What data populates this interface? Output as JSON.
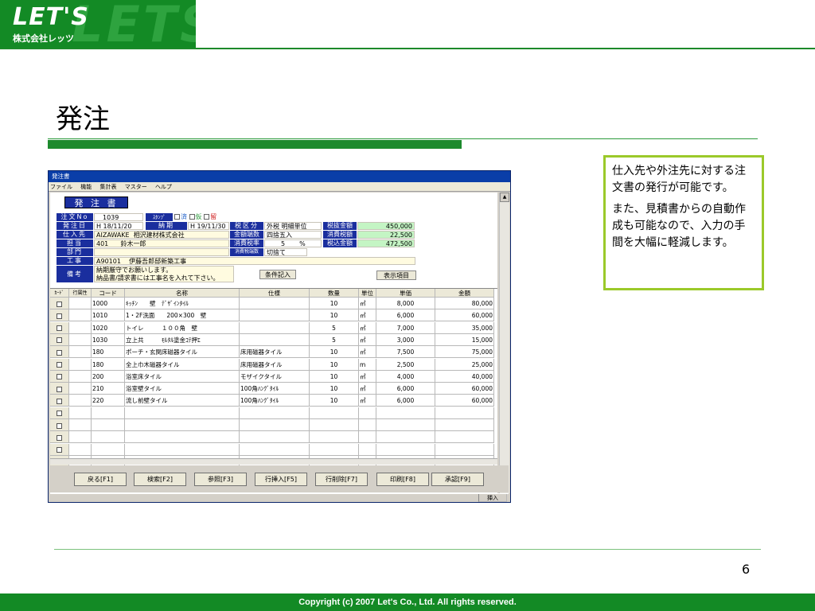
{
  "brand": {
    "logo_text": "LET'S",
    "watermark": "LETS",
    "company": "株式会社レッツ"
  },
  "slide": {
    "title": "発注",
    "page_number": "6",
    "footer": "Copyright (c) 2007 Let's Co., Ltd. All rights reserved.",
    "note_p1": "仕入先や外注先に対する注文書の発行が可能です。",
    "note_p2": "また、見積書からの自動作成も可能なので、入力の手間を大幅に軽減します。"
  },
  "window": {
    "title": "発注書",
    "menu": [
      "ファイル",
      "機能",
      "集計表",
      "マスター",
      "ヘルプ"
    ],
    "form_title": "発 注 書",
    "status_cell": "挿入"
  },
  "form": {
    "order_no_label": "注文No",
    "order_no": "1039",
    "stamp_label": "ｽﾀﾝﾌﾟ",
    "stamps": [
      "済",
      "仮",
      "留"
    ],
    "order_date_label": "発注日",
    "order_date": "H 18/11/20",
    "delivery_label": "納期",
    "delivery": "H 19/11/30",
    "supplier_label": "仕入先",
    "supplier_code": "AIZAWAKE",
    "supplier_name": "相沢建材株式会社",
    "staff_label": "担当",
    "staff_code": "401",
    "staff_name": "鈴木一郎",
    "dept_label": "部門",
    "project_label": "工事",
    "project_code": "A90101",
    "project_name": "伊藤吾郎邸新築工事",
    "notes_label": "備考",
    "notes_line1": "納期厳守でお願いします。",
    "notes_line2": "納品書/請求書には工事名を入れて下さい。",
    "tax_type_label": "税区分",
    "tax_type": "外税 明細単位",
    "rounding_label": "金額端数",
    "rounding": "四捨五入",
    "tax_rate_label": "消費税率",
    "tax_rate": "5",
    "tax_rate_unit": "%",
    "tax_round_label": "消費税端数",
    "tax_round": "切捨て",
    "pretax_label": "税抜金額",
    "pretax": "450,000",
    "tax_label": "消費税額",
    "tax": "22,500",
    "total_label": "税込金額",
    "total": "472,500",
    "condition_button": "条件記入",
    "display_button": "表示項目"
  },
  "grid": {
    "headers": [
      "ｶｰﾄﾞ",
      "行属性",
      "コード",
      "名称",
      "仕様",
      "数量",
      "単位",
      "単価",
      "金額"
    ],
    "rows": [
      {
        "code": "1000",
        "name": "ｷｯﾁﾝ　　壁　ﾃﾞｻﾞｲﾝﾀｲﾙ",
        "spec": "",
        "qty": "10",
        "unit": "㎡",
        "price": "8,000",
        "amount": "80,000"
      },
      {
        "code": "1010",
        "name": "1・2F洗面　　200×300　壁",
        "spec": "",
        "qty": "10",
        "unit": "㎡",
        "price": "6,000",
        "amount": "60,000"
      },
      {
        "code": "1020",
        "name": "トイレ　　　１００角　壁",
        "spec": "",
        "qty": "5",
        "unit": "㎡",
        "price": "7,000",
        "amount": "35,000"
      },
      {
        "code": "1030",
        "name": "立上共　　　ﾓﾙﾀﾙ塗金ｺﾃ押ｴ",
        "spec": "",
        "qty": "5",
        "unit": "㎡",
        "price": "3,000",
        "amount": "15,000"
      },
      {
        "code": "180",
        "name": "ポーチ・玄関床磁器タイル",
        "spec": "床用磁器タイル",
        "qty": "10",
        "unit": "㎡",
        "price": "7,500",
        "amount": "75,000"
      },
      {
        "code": "180",
        "name": "全上巾木磁器タイル",
        "spec": "床用磁器タイル",
        "qty": "10",
        "unit": "m",
        "price": "2,500",
        "amount": "25,000"
      },
      {
        "code": "200",
        "name": "浴室床タイル",
        "spec": "モザイクタイル",
        "qty": "10",
        "unit": "㎡",
        "price": "4,000",
        "amount": "40,000"
      },
      {
        "code": "210",
        "name": "浴室壁タイル",
        "spec": "100角ﾊﾝｸﾞﾀｲﾙ",
        "qty": "10",
        "unit": "㎡",
        "price": "6,000",
        "amount": "60,000"
      },
      {
        "code": "220",
        "name": "流し前壁タイル",
        "spec": "100角ﾊﾝｸﾞﾀｲﾙ",
        "qty": "10",
        "unit": "㎡",
        "price": "6,000",
        "amount": "60,000"
      }
    ],
    "empty_rows": 6
  },
  "function_buttons": [
    "戻る[F1]",
    "検索[F2]",
    "参照[F3]",
    "行挿入[F5]",
    "行削除[F7]",
    "印刷[F8]",
    "承認[F9]"
  ],
  "colors": {
    "brand_green": "#138a25",
    "label_blue": "#1a2e9e",
    "field_yellow": "#fffbe0",
    "total_green": "#c4f5c4",
    "note_border": "#9bc92a"
  }
}
